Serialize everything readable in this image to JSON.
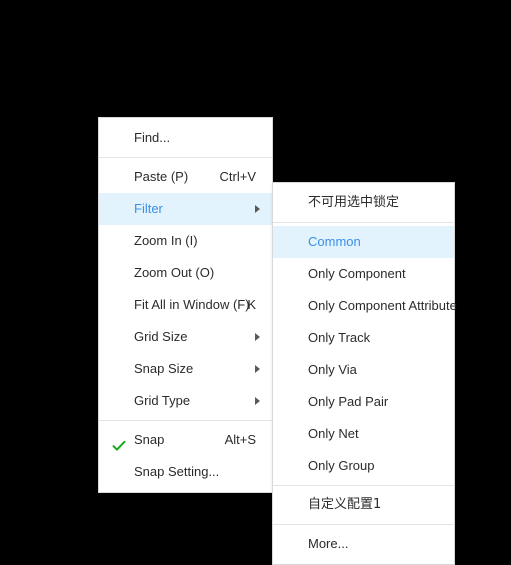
{
  "colors": {
    "background": "#000000",
    "menu_bg": "#ffffff",
    "menu_border": "#d8d8d8",
    "highlight_bg": "#e2f3fd",
    "highlight_text": "#3b8fe8",
    "text": "#2b2b2b",
    "separator": "#e4e4e4",
    "check_green": "#1aa81a"
  },
  "context_menu": {
    "items": [
      {
        "label": "Find...",
        "shortcut": "",
        "type": "item",
        "highlighted": false,
        "checked": false,
        "submenu": false
      },
      {
        "type": "separator"
      },
      {
        "label": "Paste (P)",
        "shortcut": "Ctrl+V",
        "type": "item",
        "highlighted": false,
        "checked": false,
        "submenu": false
      },
      {
        "label": "Filter",
        "shortcut": "",
        "type": "item",
        "highlighted": true,
        "checked": false,
        "submenu": true
      },
      {
        "label": "Zoom In (I)",
        "shortcut": "",
        "type": "item",
        "highlighted": false,
        "checked": false,
        "submenu": false
      },
      {
        "label": "Zoom Out (O)",
        "shortcut": "",
        "type": "item",
        "highlighted": false,
        "checked": false,
        "submenu": false
      },
      {
        "label": "Fit All in Window (F)",
        "shortcut": "K",
        "type": "item",
        "highlighted": false,
        "checked": false,
        "submenu": false
      },
      {
        "label": "Grid Size",
        "shortcut": "",
        "type": "item",
        "highlighted": false,
        "checked": false,
        "submenu": true
      },
      {
        "label": "Snap Size",
        "shortcut": "",
        "type": "item",
        "highlighted": false,
        "checked": false,
        "submenu": true
      },
      {
        "label": "Grid Type",
        "shortcut": "",
        "type": "item",
        "highlighted": false,
        "checked": false,
        "submenu": true
      },
      {
        "type": "separator"
      },
      {
        "label": "Snap",
        "shortcut": "Alt+S",
        "type": "item",
        "highlighted": false,
        "checked": true,
        "submenu": false
      },
      {
        "label": "Snap Setting...",
        "shortcut": "",
        "type": "item",
        "highlighted": false,
        "checked": false,
        "submenu": false
      }
    ]
  },
  "filter_submenu": {
    "items": [
      {
        "label": "不可用选中锁定",
        "type": "item",
        "highlighted": false,
        "cjk": true
      },
      {
        "type": "separator"
      },
      {
        "label": "Common",
        "type": "item",
        "highlighted": true,
        "cjk": false
      },
      {
        "label": "Only Component",
        "type": "item",
        "highlighted": false,
        "cjk": false
      },
      {
        "label": "Only Component Attribute",
        "type": "item",
        "highlighted": false,
        "cjk": false
      },
      {
        "label": "Only Track",
        "type": "item",
        "highlighted": false,
        "cjk": false
      },
      {
        "label": "Only Via",
        "type": "item",
        "highlighted": false,
        "cjk": false
      },
      {
        "label": "Only Pad Pair",
        "type": "item",
        "highlighted": false,
        "cjk": false
      },
      {
        "label": "Only Net",
        "type": "item",
        "highlighted": false,
        "cjk": false
      },
      {
        "label": "Only Group",
        "type": "item",
        "highlighted": false,
        "cjk": false
      },
      {
        "type": "separator"
      },
      {
        "label": "自定义配置1",
        "type": "item",
        "highlighted": false,
        "cjk": true
      },
      {
        "type": "separator"
      },
      {
        "label": "More...",
        "type": "item",
        "highlighted": false,
        "cjk": false
      }
    ]
  }
}
